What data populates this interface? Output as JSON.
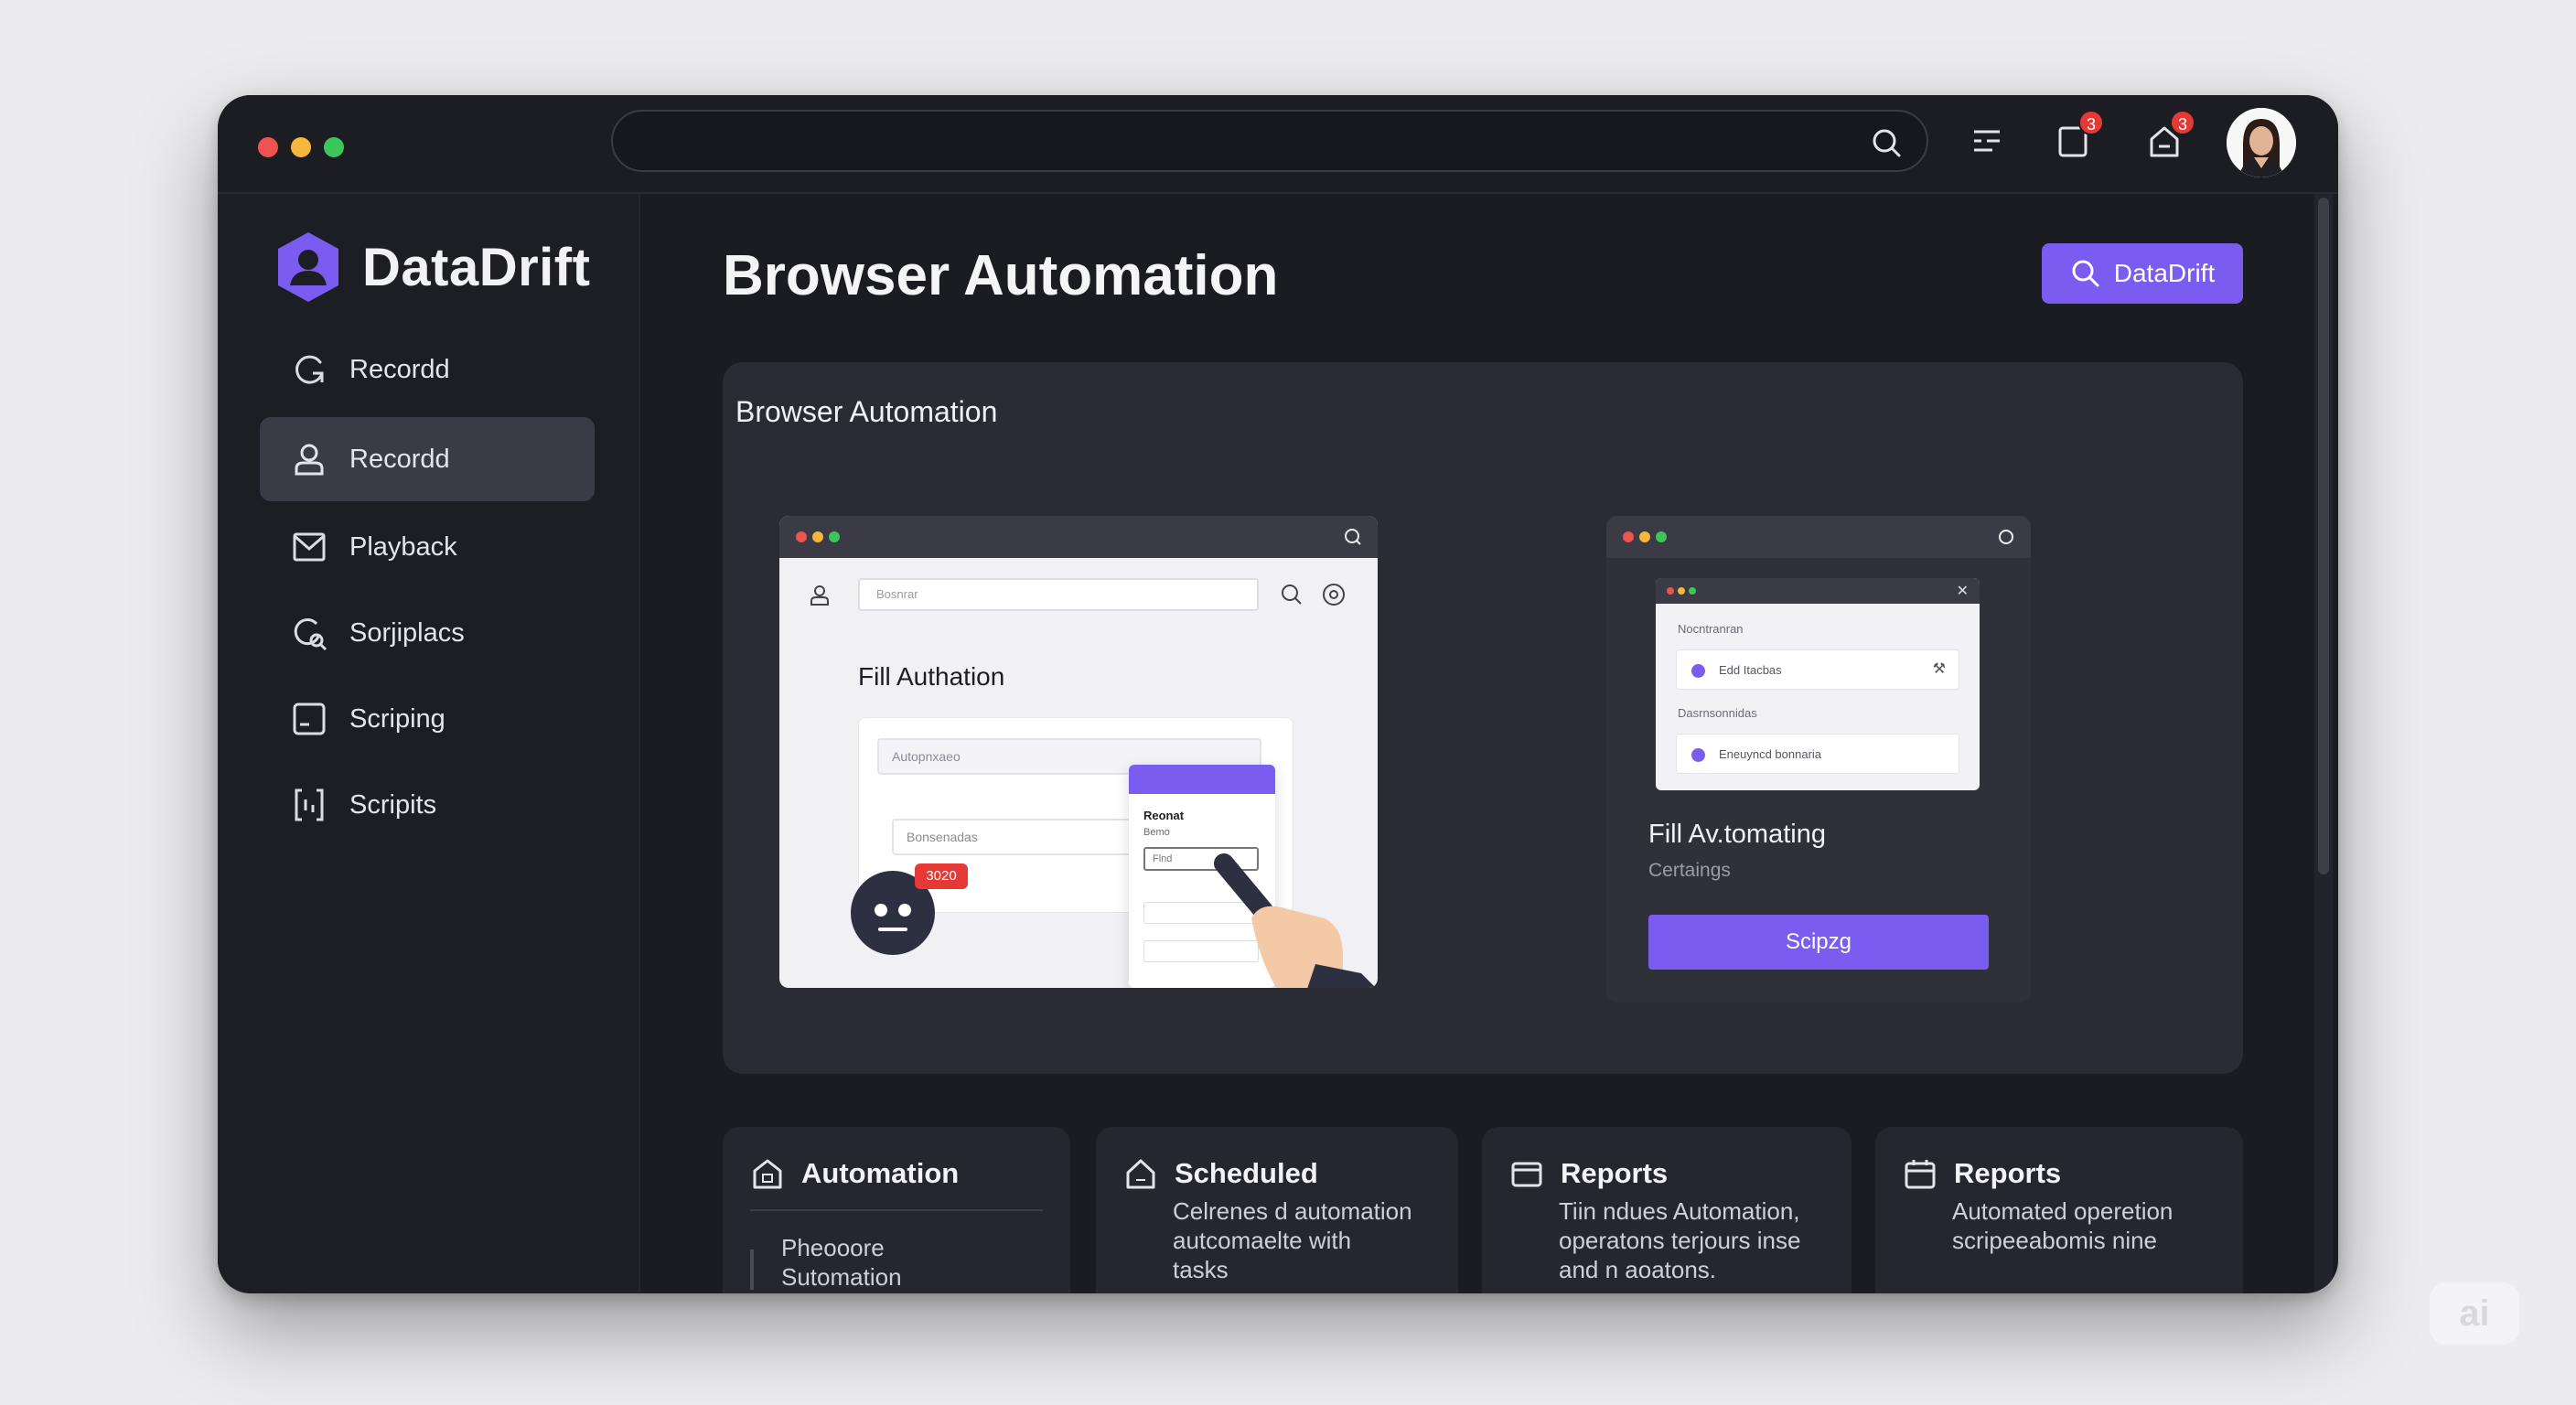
{
  "titlebar": {
    "search_placeholder": "",
    "notifications_badge": "3",
    "alerts_badge": "3"
  },
  "sidebar": {
    "brand": "DataDrift",
    "items": [
      {
        "label": "Recordd",
        "icon": "refresh-icon",
        "active": false
      },
      {
        "label": "Recordd",
        "icon": "user-icon",
        "active": true
      },
      {
        "label": "Playback",
        "icon": "envelope-icon",
        "active": false
      },
      {
        "label": "Sorjiplacs",
        "icon": "search-refresh-icon",
        "active": false
      },
      {
        "label": "Scriping",
        "icon": "terminal-icon",
        "active": false
      },
      {
        "label": "Scripits",
        "icon": "bracket-icon",
        "active": false
      }
    ]
  },
  "main": {
    "title": "Browser Automation",
    "action_button": "DataDrift",
    "panel": {
      "title": "Browser Automation",
      "mock1": {
        "address": "Bosnrar",
        "heading": "Fill Authation",
        "field1": "Autopnxaeo",
        "field2": "Bonsenadas",
        "popup_title": "Reonat",
        "popup_sub": "Bemo",
        "popup_field": "Flnd",
        "badge": "3020"
      },
      "mock2": {
        "label1": "Nocntranran",
        "option1": "Edd Itacbas",
        "label2": "Dasrnsonnidas",
        "option2": "Eneuyncd bonnaria",
        "title": "Fill Av.tomating",
        "subtitle": "Certaings",
        "button": "Scipzg"
      }
    }
  },
  "cards": [
    {
      "title": "Automation",
      "icon": "home-lock-icon",
      "body": [
        "Pheooore",
        "Sutomation"
      ]
    },
    {
      "title": "Scheduled",
      "icon": "house-icon",
      "body": [
        "Celrenes d automation",
        "autcomaelte with",
        "tasks"
      ]
    },
    {
      "title": "Reports",
      "icon": "folder-icon",
      "body": [
        "Tiin ndues Automation,",
        "operatons terjours inse",
        "and n aoatons."
      ]
    },
    {
      "title": "Reports",
      "icon": "calendar-icon",
      "body": [
        "Automated operetion",
        "scripeeabomis nine"
      ]
    }
  ],
  "colors": {
    "accent": "#7b5cf0",
    "badge": "#e53935",
    "window_bg": "#1b1c22",
    "panel_bg": "#2a2b33"
  },
  "watermark": "ai"
}
